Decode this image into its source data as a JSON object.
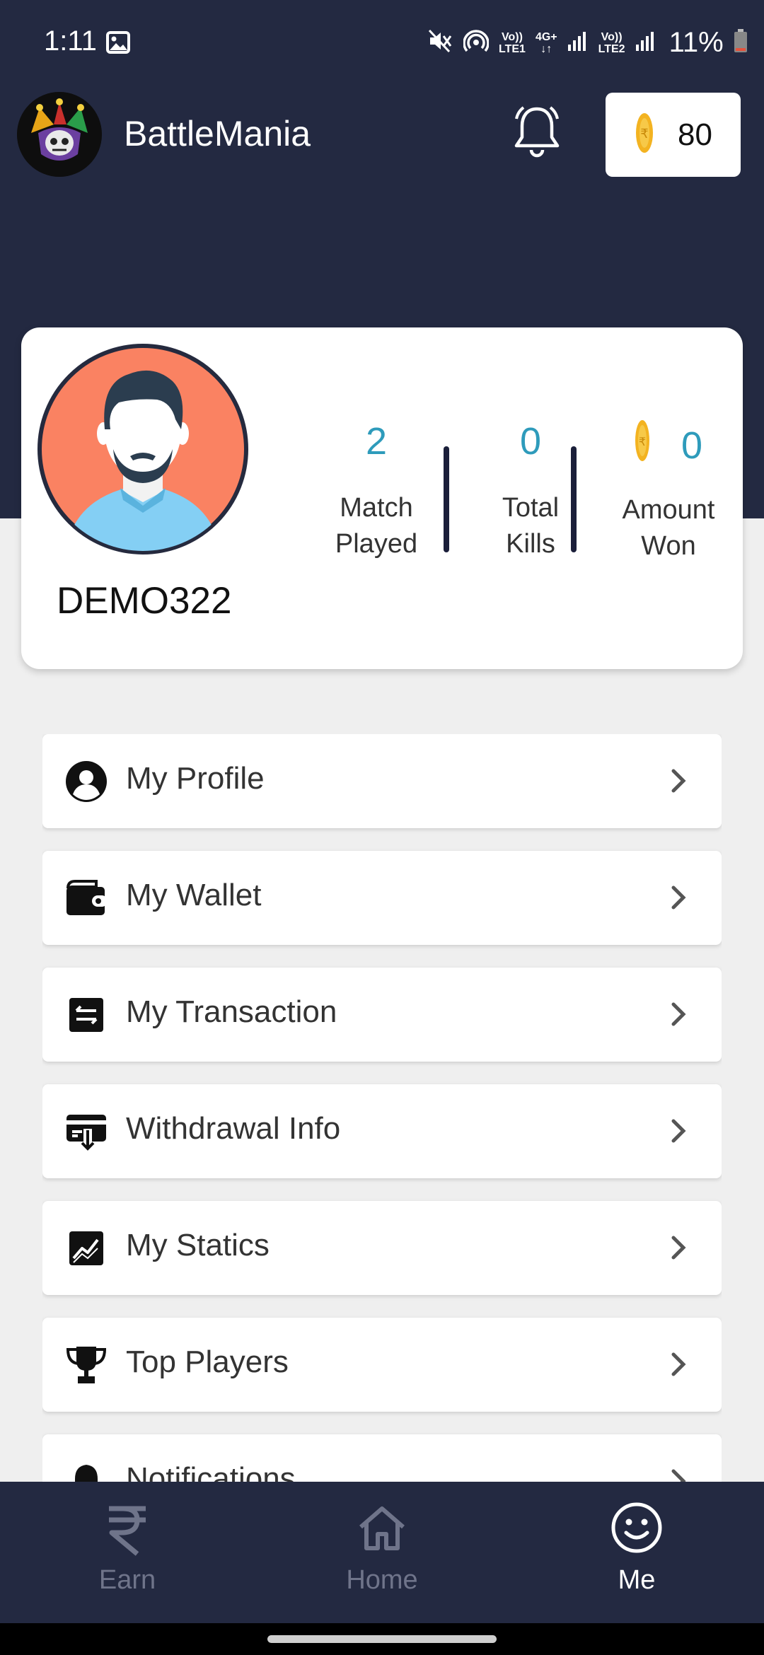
{
  "status_bar": {
    "time": "1:11",
    "sim1_top": "Vo))",
    "sim1_bottom": "LTE1",
    "net_type": "4G+",
    "sim2_top": "Vo))",
    "sim2_bottom": "LTE2",
    "battery": "11%"
  },
  "app_bar": {
    "title": "BattleMania",
    "coins": "80"
  },
  "profile": {
    "username": "DEMO322",
    "stats": [
      {
        "value": "2",
        "label_line1": "Match",
        "label_line2": "Played"
      },
      {
        "value": "0",
        "label_line1": "Total",
        "label_line2": "Kills"
      },
      {
        "value": "0",
        "label_line1": "Amount",
        "label_line2": "Won"
      }
    ]
  },
  "menu": [
    {
      "label": "My Profile",
      "icon": "user-circle-icon"
    },
    {
      "label": "My Wallet",
      "icon": "wallet-icon"
    },
    {
      "label": "My Transaction",
      "icon": "transaction-icon"
    },
    {
      "label": "Withdrawal Info",
      "icon": "withdrawal-icon"
    },
    {
      "label": "My Statics",
      "icon": "chart-icon"
    },
    {
      "label": "Top Players",
      "icon": "trophy-icon"
    },
    {
      "label": "Notifications",
      "icon": "bell-icon"
    }
  ],
  "bottom_nav": [
    {
      "label": "Earn",
      "icon": "rupee-icon",
      "active": false
    },
    {
      "label": "Home",
      "icon": "home-icon",
      "active": false
    },
    {
      "label": "Me",
      "icon": "smiley-icon",
      "active": true
    }
  ],
  "colors": {
    "header": "#232941",
    "accent": "#2e9bbb",
    "coin": "#f3b321",
    "nav_inactive": "#6f748a",
    "nav_active": "#ffffff"
  }
}
